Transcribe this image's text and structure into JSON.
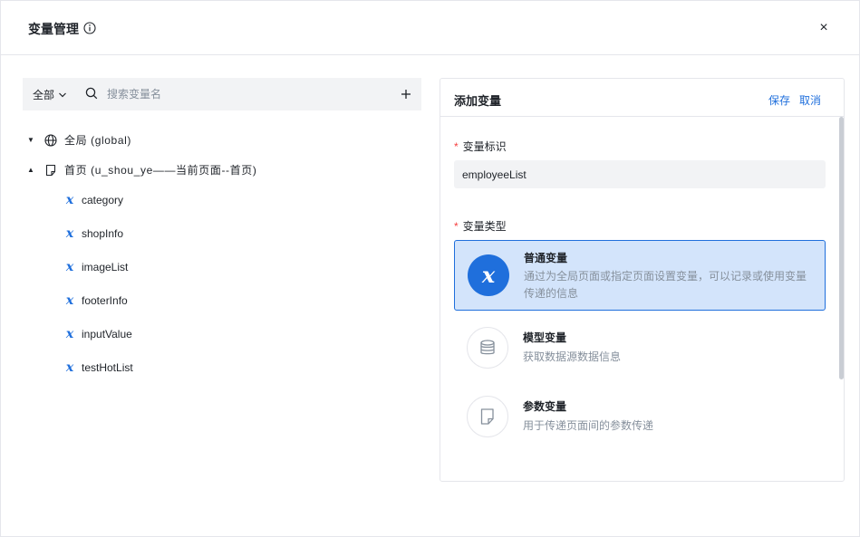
{
  "dialog": {
    "title": "变量管理",
    "close_label": "×"
  },
  "toolbar": {
    "scope": "全部",
    "search_placeholder": "搜索变量名",
    "add_label": "+"
  },
  "tree": {
    "global_label": "全局 (global)",
    "page_label": "首页 (u_shou_ye——当前页面--首页)",
    "variables": [
      "category",
      "shopInfo",
      "imageList",
      "footerInfo",
      "inputValue",
      "testHotList"
    ]
  },
  "panel": {
    "title": "添加变量",
    "save_label": "保存",
    "cancel_label": "取消",
    "id_label": "变量标识",
    "id_value": "employeeList",
    "type_label": "变量类型",
    "types": [
      {
        "name": "普通变量",
        "desc": "通过为全局页面或指定页面设置变量，可以记录或使用变量传递的信息",
        "icon": "variable-x-icon"
      },
      {
        "name": "模型变量",
        "desc": "获取数据源数据信息",
        "icon": "database-icon"
      },
      {
        "name": "参数变量",
        "desc": "用于传递页面间的参数传递",
        "icon": "document-icon"
      }
    ]
  },
  "colors": {
    "accent": "#1f6fdc",
    "selected_bg": "#d3e4fb",
    "required": "#f53f3f",
    "muted": "#86909c"
  }
}
